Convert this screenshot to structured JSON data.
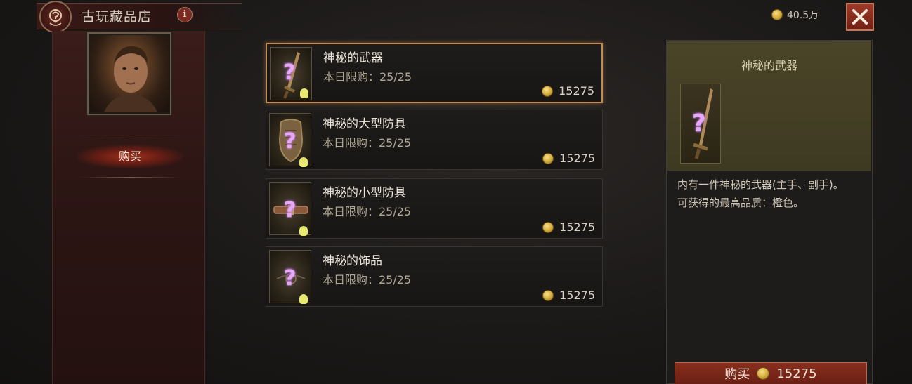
{
  "header": {
    "title": "古玩藏品店",
    "info_icon": "i"
  },
  "currency": {
    "amount": "40.5万",
    "icon": "gold-coin-icon"
  },
  "sidebar": {
    "tab_buy": "购买"
  },
  "items": [
    {
      "name": "神秘的武器",
      "limit": "本日限购：25/25",
      "price": "15275",
      "selected": true,
      "icon": "mystery-weapon-icon"
    },
    {
      "name": "神秘的大型防具",
      "limit": "本日限购：25/25",
      "price": "15275",
      "selected": false,
      "icon": "mystery-large-armor-icon"
    },
    {
      "name": "神秘的小型防具",
      "limit": "本日限购：25/25",
      "price": "15275",
      "selected": false,
      "icon": "mystery-small-armor-icon"
    },
    {
      "name": "神秘的饰品",
      "limit": "本日限购：25/25",
      "price": "15275",
      "selected": false,
      "icon": "mystery-jewelry-icon"
    }
  ],
  "detail": {
    "title": "神秘的武器",
    "desc_line1": "内有一件神秘的武器(主手、副手)。",
    "desc_line2": "可获得的最高品质：橙色。",
    "buy_label": "购买",
    "buy_price": "15275"
  },
  "colors": {
    "accent_red": "#8a2e1e",
    "selection_gold": "#c08a50",
    "coin_gold": "#d8b040"
  }
}
